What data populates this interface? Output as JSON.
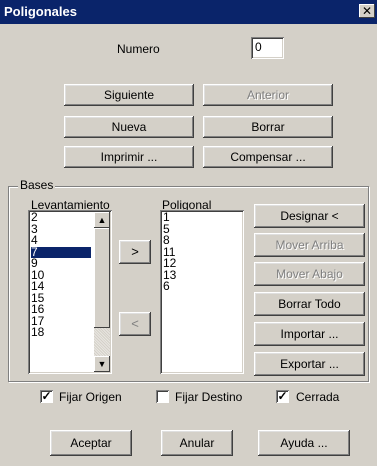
{
  "window": {
    "title": "Poligonales",
    "close_glyph": "✕"
  },
  "numero": {
    "label": "Numero",
    "value": "0"
  },
  "buttons": {
    "siguiente": "Siguiente",
    "anterior": "Anterior",
    "nueva": "Nueva",
    "borrar": "Borrar",
    "imprimir": "Imprimir ...",
    "compensar": "Compensar ..."
  },
  "bases": {
    "title": "Bases",
    "levantamiento": {
      "label": "Levantamiento",
      "items": [
        "2",
        "3",
        "4",
        "7",
        "9",
        "10",
        "14",
        "15",
        "16",
        "17",
        "18"
      ],
      "selected": "7"
    },
    "poligonal": {
      "label": "Poligonal",
      "items": [
        "1",
        "5",
        "8",
        "11",
        "12",
        "13",
        "6"
      ]
    },
    "add_arrow": ">",
    "remove_arrow": "<",
    "designar": "Designar <",
    "mover_arriba": "Mover Arriba",
    "mover_abajo": "Mover Abajo",
    "borrar_todo": "Borrar Todo",
    "importar": "Importar ...",
    "exportar": "Exportar ..."
  },
  "checks": {
    "fijar_origen": {
      "label": "Fijar Origen",
      "checked": true
    },
    "fijar_destino": {
      "label": "Fijar Destino",
      "checked": false
    },
    "cerrada": {
      "label": "Cerrada",
      "checked": true
    }
  },
  "footer": {
    "aceptar": "Aceptar",
    "anular": "Anular",
    "ayuda": "Ayuda ..."
  }
}
